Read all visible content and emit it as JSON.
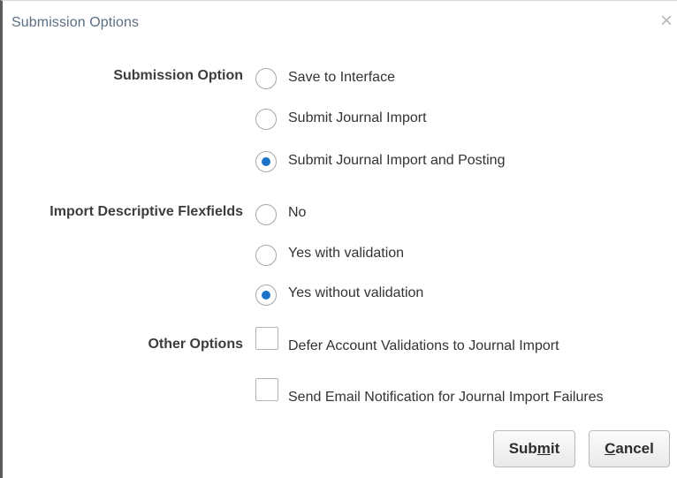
{
  "dialog": {
    "title": "Submission Options",
    "close_symbol": "×"
  },
  "submission_option": {
    "label": "Submission Option",
    "options": [
      {
        "label": "Save to Interface",
        "selected": false
      },
      {
        "label": "Submit Journal Import",
        "selected": false
      },
      {
        "label": "Submit Journal Import and Posting",
        "selected": true
      }
    ]
  },
  "import_dff": {
    "label": "Import Descriptive Flexfields",
    "options": [
      {
        "label": "No",
        "selected": false
      },
      {
        "label": "Yes with validation",
        "selected": false
      },
      {
        "label": "Yes without validation",
        "selected": true
      }
    ]
  },
  "other_options": {
    "label": "Other Options",
    "items": [
      {
        "label": "Defer Account Validations to Journal Import",
        "checked": false
      },
      {
        "label": "Send Email Notification for Journal Import Failures",
        "checked": false
      }
    ]
  },
  "buttons": {
    "submit": {
      "label": "Submit",
      "mnemonic": "m"
    },
    "cancel": {
      "label": "Cancel",
      "mnemonic": "C"
    }
  },
  "colors": {
    "accent": "#1a73c7",
    "title": "#5b6e82"
  },
  "icons": {
    "close": "close-icon"
  }
}
